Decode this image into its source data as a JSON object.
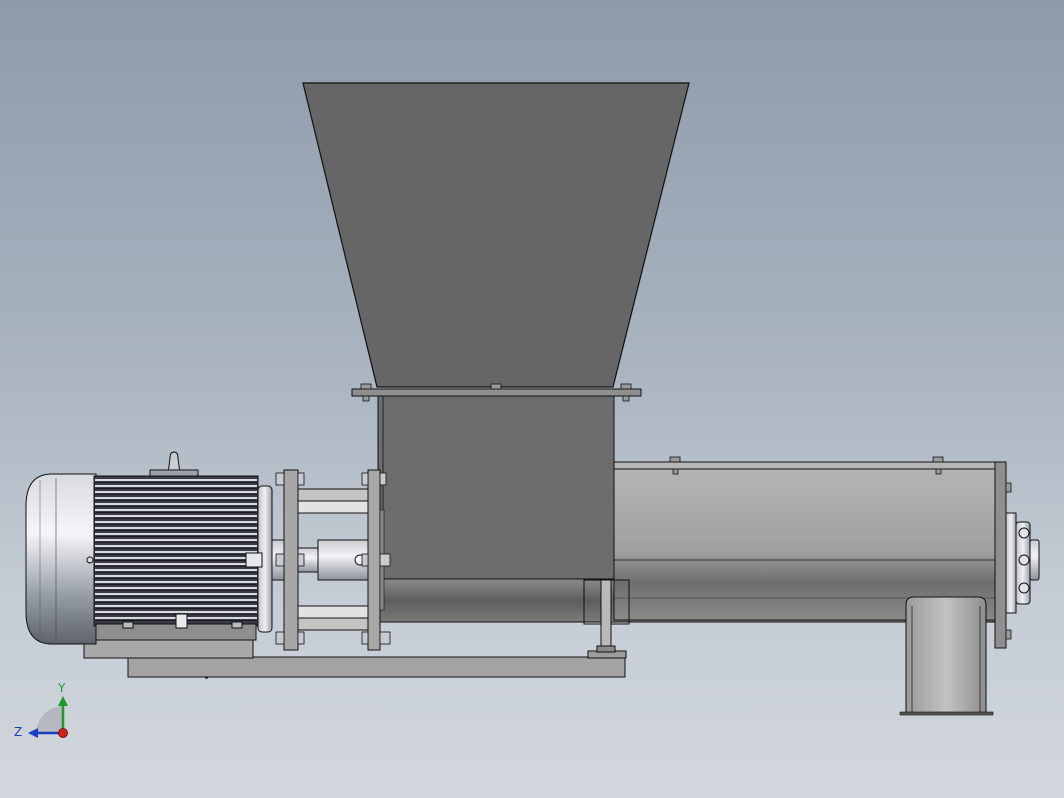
{
  "triad": {
    "y_label": "Y",
    "z_label": "Z",
    "y_color": "#1f9a2a",
    "z_color": "#1a3fbf",
    "x_color": "#d02020"
  },
  "colors": {
    "hopper": "#666666",
    "neck": "#707070",
    "trough": "#a9a9a9",
    "motor_body": "#3a3d45",
    "outline": "#111111"
  }
}
